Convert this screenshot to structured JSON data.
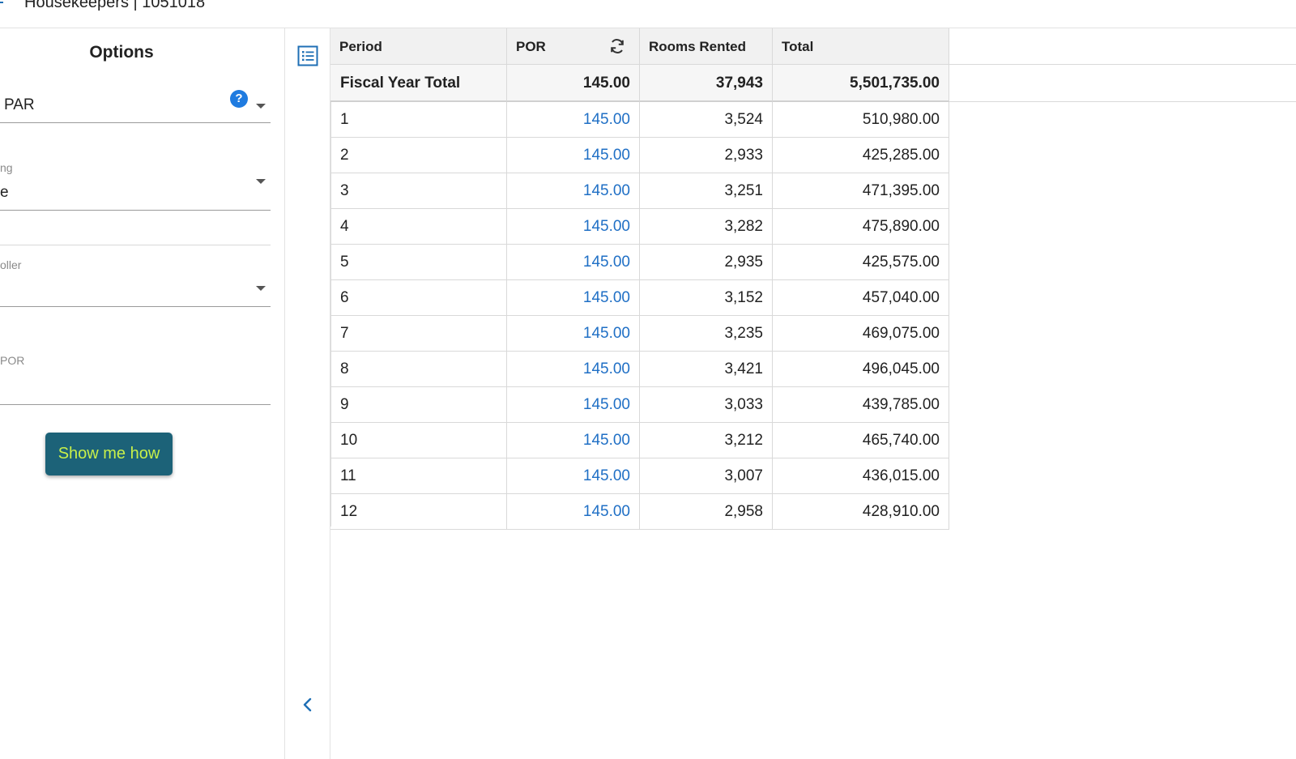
{
  "window": {
    "title": "Housekeepers | 1051018"
  },
  "options": {
    "title": "Options",
    "fields": [
      {
        "label": "",
        "value": "PAR",
        "has_help": true
      },
      {
        "label": "ng",
        "value": "e"
      },
      {
        "label": "oller",
        "value": ""
      },
      {
        "label": "POR",
        "value": ""
      }
    ],
    "help_glyph": "?",
    "show_me_how_label": "Show me how"
  },
  "icons": {
    "list": "list-view-icon",
    "collapse": "chevron-left-icon",
    "refresh": "refresh-icon"
  },
  "colors": {
    "link": "#1f6fc5",
    "button_bg": "#1c6278",
    "button_text": "#c8f04a",
    "help": "#1f7be0"
  },
  "grid": {
    "columns": [
      "Period",
      "POR",
      "Rooms Rented",
      "Total"
    ],
    "total_row": {
      "period": "Fiscal Year Total",
      "por": "145.00",
      "rooms": "37,943",
      "total": "5,501,735.00"
    },
    "rows": [
      {
        "period": "1",
        "por": "145.00",
        "rooms": "3,524",
        "total": "510,980.00"
      },
      {
        "period": "2",
        "por": "145.00",
        "rooms": "2,933",
        "total": "425,285.00"
      },
      {
        "period": "3",
        "por": "145.00",
        "rooms": "3,251",
        "total": "471,395.00"
      },
      {
        "period": "4",
        "por": "145.00",
        "rooms": "3,282",
        "total": "475,890.00"
      },
      {
        "period": "5",
        "por": "145.00",
        "rooms": "2,935",
        "total": "425,575.00"
      },
      {
        "period": "6",
        "por": "145.00",
        "rooms": "3,152",
        "total": "457,040.00"
      },
      {
        "period": "7",
        "por": "145.00",
        "rooms": "3,235",
        "total": "469,075.00"
      },
      {
        "period": "8",
        "por": "145.00",
        "rooms": "3,421",
        "total": "496,045.00"
      },
      {
        "period": "9",
        "por": "145.00",
        "rooms": "3,033",
        "total": "439,785.00"
      },
      {
        "period": "10",
        "por": "145.00",
        "rooms": "3,212",
        "total": "465,740.00"
      },
      {
        "period": "11",
        "por": "145.00",
        "rooms": "3,007",
        "total": "436,015.00"
      },
      {
        "period": "12",
        "por": "145.00",
        "rooms": "2,958",
        "total": "428,910.00"
      }
    ]
  }
}
